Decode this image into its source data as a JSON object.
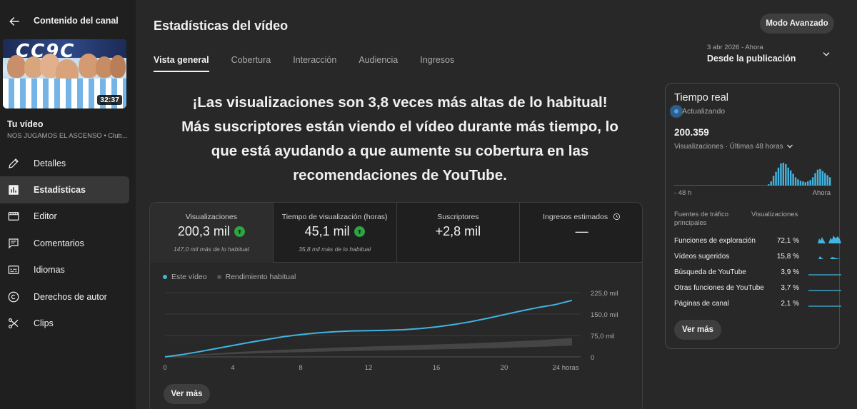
{
  "sidebar": {
    "title": "Contenido del canal",
    "video_duration": "32:37",
    "video_label": "Tu vídeo",
    "video_name": "NOS JUGAMOS EL ASCENSO • Club...",
    "items": [
      {
        "label": "Detalles",
        "icon": "pencil-icon"
      },
      {
        "label": "Estadísticas",
        "icon": "analytics-icon"
      },
      {
        "label": "Editor",
        "icon": "editor-icon"
      },
      {
        "label": "Comentarios",
        "icon": "comment-icon"
      },
      {
        "label": "Idiomas",
        "icon": "subtitles-icon"
      },
      {
        "label": "Derechos de autor",
        "icon": "copyright-icon"
      },
      {
        "label": "Clips",
        "icon": "scissors-icon"
      }
    ]
  },
  "header": {
    "title": "Estadísticas del vídeo",
    "advanced_button": "Modo Avanzado",
    "tabs": [
      "Vista general",
      "Cobertura",
      "Interacción",
      "Audiencia",
      "Ingresos"
    ],
    "date_sub": "3 abr 2026 - Ahora",
    "date_main": "Desde la publicación"
  },
  "headline": "¡Las visualizaciones son 3,8 veces más altas de lo habitual! Más suscriptores están viendo el vídeo durante más tiempo, lo que está ayudando a que aumente su cobertura en las recomendaciones de YouTube.",
  "metrics": [
    {
      "label": "Visualizaciones",
      "value": "200,3 mil",
      "note": "147,0 mil más de lo habitual"
    },
    {
      "label": "Tiempo de visualización (horas)",
      "value": "45,1 mil",
      "note": "35,8 mil más de lo habitual"
    },
    {
      "label": "Suscriptores",
      "value": "+2,8 mil",
      "note": ""
    },
    {
      "label": "Ingresos estimados",
      "value": "—",
      "note": ""
    }
  ],
  "legend": {
    "series1": "Este vídeo",
    "series2": "Rendimiento habitual"
  },
  "see_more": "Ver más",
  "colors": {
    "accent": "#3ea6ff",
    "line": "#41b4e1",
    "positive": "#2ba640",
    "background": "#282828",
    "sidebar": "#1f1f1f"
  },
  "chart_data": {
    "type": "line",
    "x_ticks": [
      "0",
      "4",
      "8",
      "12",
      "16",
      "20",
      "24 horas"
    ],
    "y_ticks": [
      "0",
      "75,0 mil",
      "150,0 mil",
      "225,0 mil"
    ],
    "xlim": [
      0,
      24
    ],
    "ylim": [
      0,
      225000
    ],
    "series": [
      {
        "name": "Este vídeo",
        "x": [
          0,
          1,
          2,
          3,
          4,
          5,
          6,
          7,
          8,
          9,
          10,
          11,
          12,
          13,
          14,
          15,
          16,
          17,
          18,
          19,
          20,
          21,
          22,
          23,
          24
        ],
        "values": [
          0,
          8000,
          18000,
          29000,
          40000,
          51000,
          61000,
          71000,
          78000,
          84000,
          88000,
          91000,
          92000,
          93000,
          95000,
          99000,
          105000,
          113000,
          123000,
          135000,
          148000,
          161000,
          173000,
          183000,
          198000
        ]
      },
      {
        "name": "Rendimiento habitual",
        "x": [
          0,
          2,
          4,
          6,
          8,
          10,
          12,
          14,
          16,
          18,
          20,
          22,
          24
        ],
        "values": [
          0,
          7000,
          13000,
          18000,
          22000,
          26000,
          29000,
          32000,
          35000,
          38000,
          42000,
          47000,
          53000
        ]
      }
    ]
  },
  "realtime": {
    "title": "Tiempo real",
    "status": "Actualizando",
    "count": "200.359",
    "caption": "Visualizaciones · Últimas 48 horas",
    "axis_left": "- 48 h",
    "axis_right": "Ahora",
    "sources_header": "Fuentes de tráfico principales",
    "views_header": "Visualizaciones",
    "bars": [
      0,
      0,
      0,
      0,
      0,
      0,
      0,
      0,
      0,
      0,
      0,
      0,
      0,
      0,
      0,
      0,
      0,
      0,
      0,
      0,
      0,
      0,
      0,
      0,
      0,
      0,
      0,
      0,
      0,
      0,
      0,
      0,
      0,
      0,
      0,
      0,
      0,
      0,
      2,
      6,
      14,
      20,
      26,
      32,
      33,
      31,
      26,
      22,
      17,
      12,
      9,
      7,
      6,
      5,
      6,
      8,
      12,
      18,
      23,
      24,
      21,
      18,
      15,
      12
    ],
    "sources": [
      {
        "name": "Funciones de exploración",
        "pct": "72,1 %"
      },
      {
        "name": "Vídeos sugeridos",
        "pct": "15,8 %"
      },
      {
        "name": "Búsqueda de YouTube",
        "pct": "3,9 %"
      },
      {
        "name": "Otras funciones de YouTube",
        "pct": "3,7 %"
      },
      {
        "name": "Páginas de canal",
        "pct": "2,1 %"
      }
    ],
    "see_more": "Ver más"
  }
}
